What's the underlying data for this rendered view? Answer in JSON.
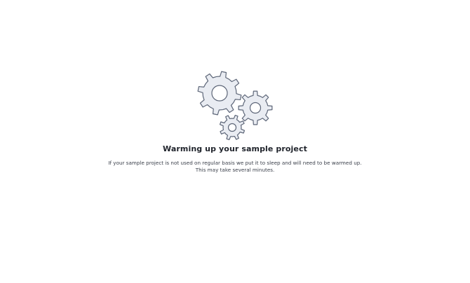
{
  "loading": {
    "illustration_icon": "gears-icon",
    "title": "Warming up your sample project",
    "description_line1": "If your sample project is not used on regular basis we put it to sleep and will need to be warmed up.",
    "description_line2": "This may take several minutes."
  },
  "colors": {
    "gear_fill": "#e9ecf2",
    "gear_stroke": "#5d6678",
    "title_text": "#1f232b",
    "body_text": "#3a3f4a"
  }
}
